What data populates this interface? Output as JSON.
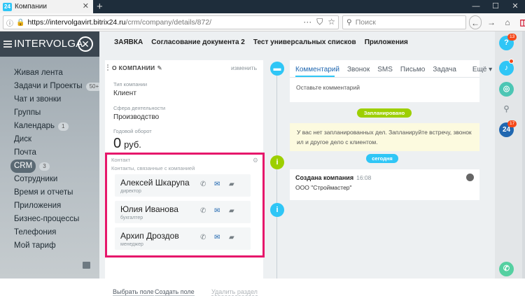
{
  "browser": {
    "tab_title": "Компании",
    "tab_icon": "24",
    "url_host": "https://intervolgavirt.bitrix24.ru",
    "url_path": "/crm/company/details/872/",
    "search_placeholder": "Поиск",
    "new_tab": "+",
    "close": "✕"
  },
  "sidebar": {
    "brand": "INTERVOLGA",
    "items": [
      {
        "label": "Живая лента",
        "count": ""
      },
      {
        "label": "Задачи и Проекты",
        "count": "50+"
      },
      {
        "label": "Чат и звонки",
        "count": ""
      },
      {
        "label": "Группы",
        "count": ""
      },
      {
        "label": "Календарь",
        "count": "1"
      },
      {
        "label": "Диск",
        "count": ""
      },
      {
        "label": "Почта",
        "count": ""
      },
      {
        "label": "CRM",
        "count": "3"
      },
      {
        "label": "Сотрудники",
        "count": ""
      },
      {
        "label": "Время и отчеты",
        "count": ""
      },
      {
        "label": "Приложения",
        "count": ""
      },
      {
        "label": "Бизнес-процессы",
        "count": ""
      },
      {
        "label": "Телефония",
        "count": ""
      },
      {
        "label": "Мой тариф",
        "count": ""
      }
    ]
  },
  "tabs_row2": [
    "ЗАЯВКА",
    "Согласование документа 2",
    "Тест универсальных списков",
    "Приложения"
  ],
  "company": {
    "section_title": "О КОМПАНИИ",
    "change_link": "изменить",
    "type_label": "Тип компании",
    "type_value": "Клиент",
    "industry_label": "Сфера деятельности",
    "industry_value": "Производство",
    "revenue_label": "Годовой оборот",
    "revenue_value": "0",
    "revenue_unit": "руб."
  },
  "contacts": {
    "title": "Контакт",
    "subtitle": "Контакты, связанные с компанией",
    "items": [
      {
        "name": "Алексей Шкарупа",
        "role": "директор"
      },
      {
        "name": "Юлия Иванова",
        "role": "бухгалтер"
      },
      {
        "name": "Архип Дроздов",
        "role": "менеджер"
      }
    ]
  },
  "card_footer": {
    "select_field": "Выбрать поле",
    "create_field": "Создать поле",
    "delete_section": "Удалить раздел"
  },
  "comment": {
    "tabs": [
      "Комментарий",
      "Звонок",
      "SMS",
      "Письмо",
      "Задача",
      "Ещё"
    ],
    "placeholder": "Оставьте комментарий"
  },
  "timeline": {
    "planned_label": "Запланировано",
    "planned_text": "У вас нет запланированных дел. Запланируйте встречу, звонок ил и другое дело с клиентом.",
    "today_label": "сегодня",
    "event_title": "Создана компания",
    "event_time": "16:08",
    "event_subject": "ООО \"Строймастер\""
  },
  "rail": {
    "help_badge": "13",
    "b24_badge": "17",
    "b24_label": "24"
  },
  "colors": {
    "accent": "#2fc6f6",
    "highlight_border": "#e6176b",
    "planned": "#9dcf00"
  }
}
